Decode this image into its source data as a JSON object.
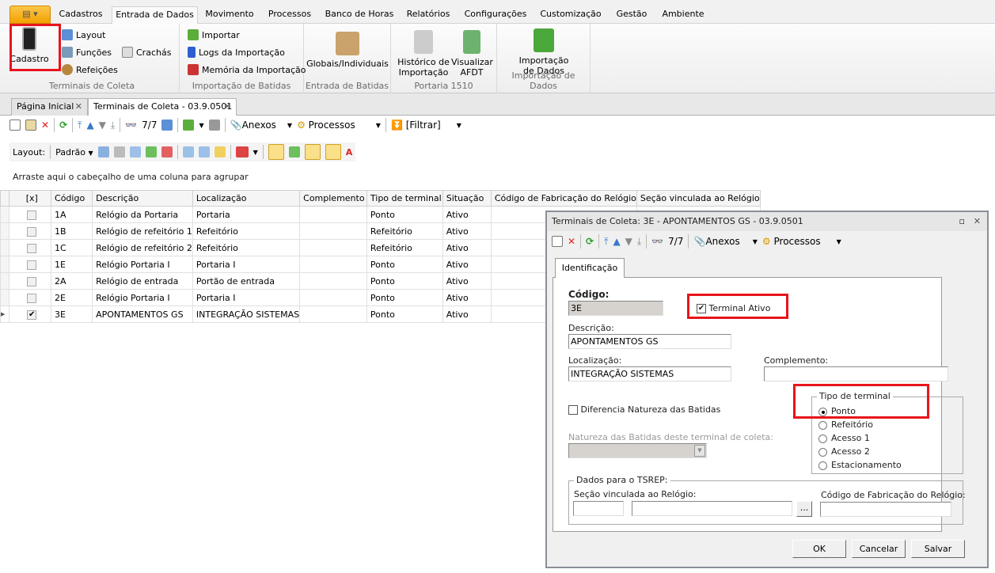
{
  "ribbon": {
    "tabs": [
      "Cadastros",
      "Entrada de Dados",
      "Movimento",
      "Processos",
      "Banco de Horas",
      "Relatórios",
      "Configurações",
      "Customização",
      "Gestão",
      "Ambiente"
    ],
    "active_tab": "Entrada de Dados",
    "groups": {
      "terminais": {
        "label": "Terminais de Coleta",
        "cadastro": "Cadastro",
        "layout": "Layout",
        "funcoes": "Funções",
        "refeicoes": "Refeições",
        "crachas": "Crachás"
      },
      "importacao": {
        "label": "Importação de Batidas",
        "importar": "Importar",
        "logs": "Logs da Importação",
        "memoria": "Memória da Importação"
      },
      "entrada": {
        "label": "Entrada de Batidas",
        "globais": "Globais/Individuais"
      },
      "portaria": {
        "label": "Portaria 1510",
        "historico1": "Histórico de",
        "historico2": "Importação",
        "visualizar1": "Visualizar",
        "visualizar2": "AFDT"
      },
      "dados": {
        "label": "Importação de Dados",
        "imp1": "Importação",
        "imp2": "de Dados"
      }
    }
  },
  "doc_tabs": [
    {
      "label": "Página Inicial"
    },
    {
      "label": "Terminais de Coleta - 03.9.0501"
    }
  ],
  "toolbar": {
    "record_count": "7/7",
    "anexos": "Anexos",
    "processos": "Processos",
    "filtrar": "[Filtrar]"
  },
  "layout_bar": {
    "label": "Layout:",
    "preset": "Padrão"
  },
  "group_hint": "Arraste aqui o cabeçalho de uma coluna para agrupar",
  "grid": {
    "columns": [
      "[x]",
      "Código",
      "Descrição",
      "Localização",
      "Complemento",
      "Tipo de terminal",
      "Situação",
      "Código de Fabricação do Relógio",
      "Seção vinculada ao Relógio"
    ],
    "rows": [
      {
        "checked": false,
        "codigo": "1A",
        "descricao": "Relógio da Portaria",
        "localizacao": "Portaria",
        "complemento": "",
        "tipo": "Ponto",
        "situacao": "Ativo"
      },
      {
        "checked": false,
        "codigo": "1B",
        "descricao": "Relógio de refeitório 1",
        "localizacao": "Refeitório",
        "complemento": "",
        "tipo": "Refeitório",
        "situacao": "Ativo"
      },
      {
        "checked": false,
        "codigo": "1C",
        "descricao": "Relógio de refeitório 2",
        "localizacao": "Refeitório",
        "complemento": "",
        "tipo": "Refeitório",
        "situacao": "Ativo"
      },
      {
        "checked": false,
        "codigo": "1E",
        "descricao": "Relógio Portaria I",
        "localizacao": "Portaria I",
        "complemento": "",
        "tipo": "Ponto",
        "situacao": "Ativo"
      },
      {
        "checked": false,
        "codigo": "2A",
        "descricao": "Relógio de entrada",
        "localizacao": "Portão de entrada",
        "complemento": "",
        "tipo": "Ponto",
        "situacao": "Ativo"
      },
      {
        "checked": false,
        "codigo": "2E",
        "descricao": "Relógio Portaria I",
        "localizacao": "Portaria I",
        "complemento": "",
        "tipo": "Ponto",
        "situacao": "Ativo"
      },
      {
        "checked": true,
        "codigo": "3E",
        "descricao": "APONTAMENTOS GS",
        "localizacao": "INTEGRAÇÃO SISTEMAS",
        "complemento": "",
        "tipo": "Ponto",
        "situacao": "Ativo"
      }
    ]
  },
  "dialog": {
    "title": "Terminais de Coleta: 3E - APONTAMENTOS GS - 03.9.0501",
    "toolbar": {
      "record_count": "7/7",
      "anexos": "Anexos",
      "processos": "Processos"
    },
    "tab": "Identificação",
    "codigo_label": "Código:",
    "codigo": "3E",
    "terminal_ativo_label": "Terminal Ativo",
    "terminal_ativo": true,
    "descricao_label": "Descrição:",
    "descricao": "APONTAMENTOS GS",
    "localizacao_label": "Localização:",
    "localizacao": "INTEGRAÇÃO SISTEMAS",
    "complemento_label": "Complemento:",
    "complemento": "",
    "diferencia_label": "Diferencia Natureza das Batidas",
    "diferencia": false,
    "natureza_label": "Natureza das Batidas deste terminal de coleta:",
    "tipo_label": "Tipo de terminal",
    "tipo_options": [
      "Ponto",
      "Refeitório",
      "Acesso 1",
      "Acesso 2",
      "Estacionamento"
    ],
    "tipo_selected": "Ponto",
    "tsrep_label": "Dados para o TSREP:",
    "secao_label": "Seção vinculada ao Relógio:",
    "browse": "...",
    "fabricacao_label": "Código de Fabricação do Relógio:",
    "buttons": {
      "ok": "OK",
      "cancel": "Cancelar",
      "save": "Salvar"
    }
  },
  "colors": {
    "highlight": "#e8141c",
    "app_button": "#f2a100"
  }
}
